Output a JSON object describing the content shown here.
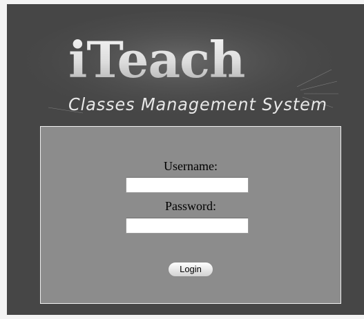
{
  "logo": {
    "title": "iTeach",
    "subtitle": "Classes Management System"
  },
  "login_form": {
    "username_label": "Username:",
    "username_value": "",
    "password_label": "Password:",
    "password_value": "",
    "login_button_label": "Login"
  },
  "colors": {
    "frame_background": "#464646",
    "panel_background": "#8c8c8c",
    "panel_border": "#f2f2f2",
    "logo_text": "#e8e8e8"
  }
}
